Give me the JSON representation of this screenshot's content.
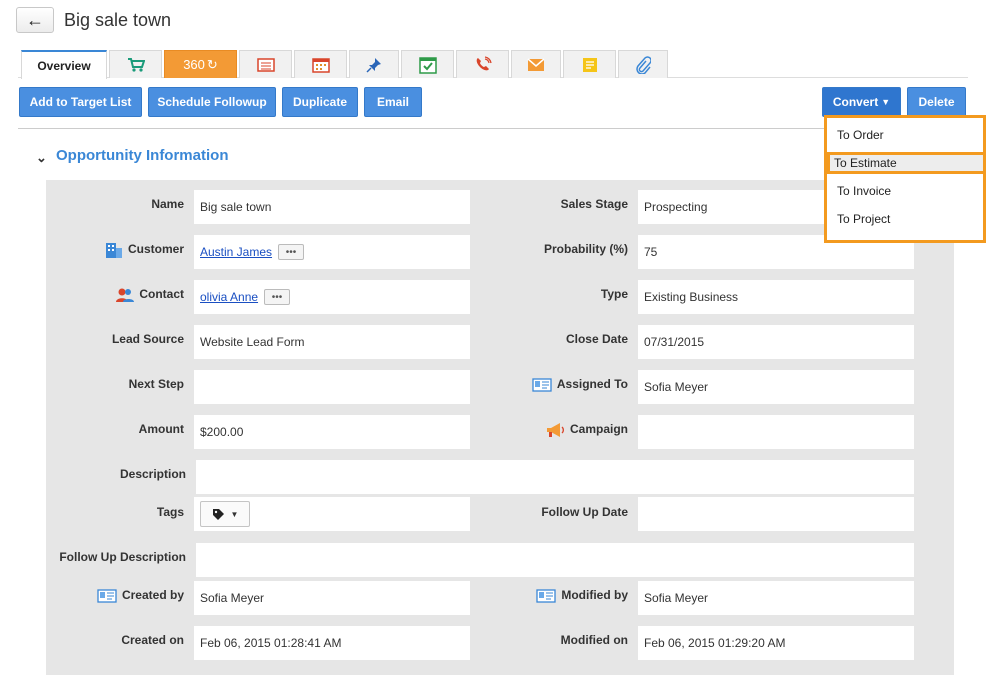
{
  "header": {
    "back_icon": "back-arrow-icon",
    "title": "Big sale town"
  },
  "tabs": [
    {
      "label": "Overview",
      "icon": ""
    },
    {
      "label": "",
      "icon": "cart-icon"
    },
    {
      "label": "360",
      "icon": "refresh-icon"
    },
    {
      "label": "",
      "icon": "list-icon"
    },
    {
      "label": "",
      "icon": "calendar-icon"
    },
    {
      "label": "",
      "icon": "pin-icon"
    },
    {
      "label": "",
      "icon": "check-calendar-icon"
    },
    {
      "label": "",
      "icon": "phone-icon"
    },
    {
      "label": "",
      "icon": "email-icon"
    },
    {
      "label": "",
      "icon": "note-icon"
    },
    {
      "label": "",
      "icon": "paperclip-icon"
    }
  ],
  "toolbar": {
    "add_target": "Add to Target List",
    "schedule": "Schedule Followup",
    "duplicate": "Duplicate",
    "email": "Email",
    "convert": "Convert",
    "delete": "Delete"
  },
  "convert_menu": {
    "items": [
      "To Order",
      "To Estimate",
      "To Invoice",
      "To Project"
    ],
    "highlight_color": "#f39a1f"
  },
  "section": {
    "title": "Opportunity Information"
  },
  "fields": {
    "name": {
      "label": "Name",
      "value": "Big sale town"
    },
    "sales_stage": {
      "label": "Sales Stage",
      "value": "Prospecting"
    },
    "customer": {
      "label": "Customer",
      "value": "Austin James"
    },
    "probability": {
      "label": "Probability (%)",
      "value": "75"
    },
    "contact": {
      "label": "Contact",
      "value": "olivia Anne"
    },
    "type": {
      "label": "Type",
      "value": "Existing Business"
    },
    "lead_source": {
      "label": "Lead Source",
      "value": "Website Lead Form"
    },
    "close_date": {
      "label": "Close Date",
      "value": "07/31/2015"
    },
    "next_step": {
      "label": "Next Step",
      "value": ""
    },
    "assigned_to": {
      "label": "Assigned To",
      "value": "Sofia Meyer"
    },
    "amount": {
      "label": "Amount",
      "value": "$200.00"
    },
    "campaign": {
      "label": "Campaign",
      "value": ""
    },
    "description": {
      "label": "Description",
      "value": ""
    },
    "tags": {
      "label": "Tags",
      "value": ""
    },
    "follow_up_date": {
      "label": "Follow Up Date",
      "value": ""
    },
    "follow_up_description": {
      "label": "Follow Up Description",
      "value": ""
    },
    "created_by": {
      "label": "Created by",
      "value": "Sofia Meyer"
    },
    "modified_by": {
      "label": "Modified by",
      "value": "Sofia Meyer"
    },
    "created_on": {
      "label": "Created on",
      "value": "Feb 06, 2015 01:28:41 AM"
    },
    "modified_on": {
      "label": "Modified on",
      "value": "Feb 06, 2015 01:29:20 AM"
    }
  },
  "colors": {
    "accent": "#3a87d6",
    "button": "#4a8fe0",
    "orange_tab": "#f39a35"
  }
}
